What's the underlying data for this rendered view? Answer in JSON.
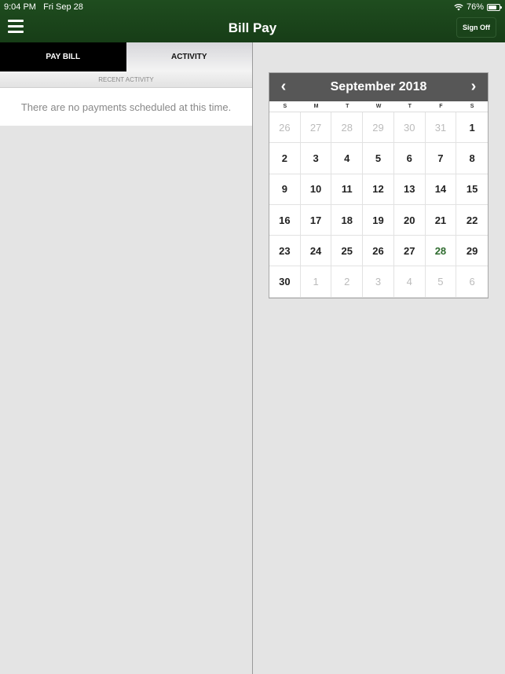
{
  "status_bar": {
    "time": "9:04 PM",
    "date": "Fri Sep 28",
    "battery": "76%",
    "battery_level": 0.76
  },
  "header": {
    "title": "Bill Pay",
    "sign_off_label": "Sign Off"
  },
  "tabs": [
    {
      "label": "PAY BILL",
      "active": true
    },
    {
      "label": "ACTIVITY",
      "active": false
    }
  ],
  "activity": {
    "section_label": "RECENT ACTIVITY",
    "empty_message": "There are no payments scheduled at this time."
  },
  "calendar": {
    "month_label": "September 2018",
    "weekdays": [
      "S",
      "M",
      "T",
      "W",
      "T",
      "F",
      "S"
    ],
    "today": "28",
    "days": [
      {
        "d": "26",
        "t": "other"
      },
      {
        "d": "27",
        "t": "other"
      },
      {
        "d": "28",
        "t": "other"
      },
      {
        "d": "29",
        "t": "other"
      },
      {
        "d": "30",
        "t": "other"
      },
      {
        "d": "31",
        "t": "other"
      },
      {
        "d": "1",
        "t": "cur"
      },
      {
        "d": "2",
        "t": "cur"
      },
      {
        "d": "3",
        "t": "cur"
      },
      {
        "d": "4",
        "t": "cur"
      },
      {
        "d": "5",
        "t": "cur"
      },
      {
        "d": "6",
        "t": "cur"
      },
      {
        "d": "7",
        "t": "cur"
      },
      {
        "d": "8",
        "t": "cur"
      },
      {
        "d": "9",
        "t": "cur"
      },
      {
        "d": "10",
        "t": "cur"
      },
      {
        "d": "11",
        "t": "cur"
      },
      {
        "d": "12",
        "t": "cur"
      },
      {
        "d": "13",
        "t": "cur"
      },
      {
        "d": "14",
        "t": "cur"
      },
      {
        "d": "15",
        "t": "cur"
      },
      {
        "d": "16",
        "t": "cur"
      },
      {
        "d": "17",
        "t": "cur"
      },
      {
        "d": "18",
        "t": "cur"
      },
      {
        "d": "19",
        "t": "cur"
      },
      {
        "d": "20",
        "t": "cur"
      },
      {
        "d": "21",
        "t": "cur"
      },
      {
        "d": "22",
        "t": "cur"
      },
      {
        "d": "23",
        "t": "cur"
      },
      {
        "d": "24",
        "t": "cur"
      },
      {
        "d": "25",
        "t": "cur"
      },
      {
        "d": "26",
        "t": "cur"
      },
      {
        "d": "27",
        "t": "cur"
      },
      {
        "d": "28",
        "t": "today"
      },
      {
        "d": "29",
        "t": "cur"
      },
      {
        "d": "30",
        "t": "cur"
      },
      {
        "d": "1",
        "t": "other"
      },
      {
        "d": "2",
        "t": "other"
      },
      {
        "d": "3",
        "t": "other"
      },
      {
        "d": "4",
        "t": "other"
      },
      {
        "d": "5",
        "t": "other"
      },
      {
        "d": "6",
        "t": "other"
      }
    ]
  },
  "colors": {
    "header_green": "#1f4d1f",
    "today_green": "#2e6b2e",
    "calendar_header": "#575757"
  }
}
